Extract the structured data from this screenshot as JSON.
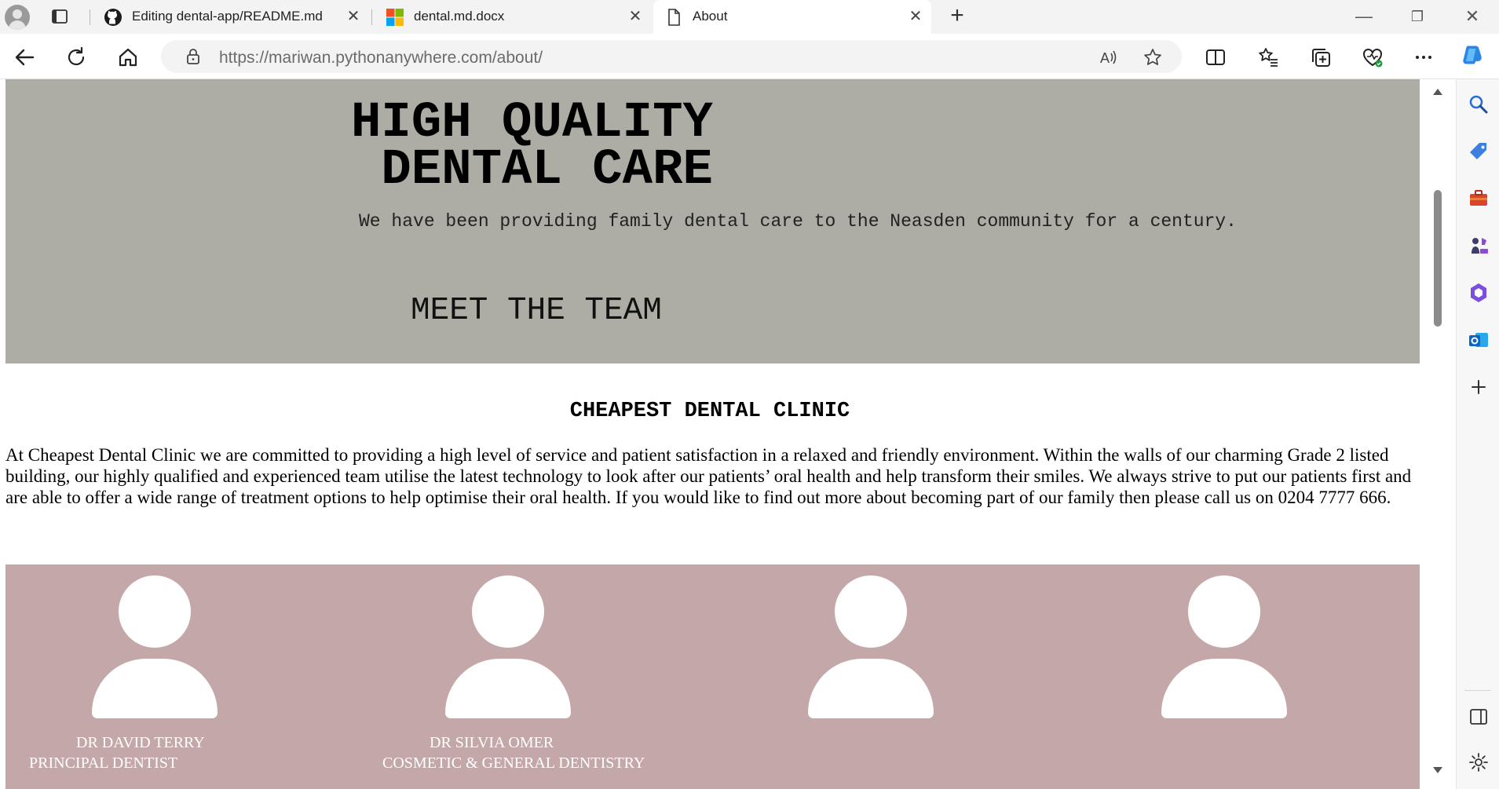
{
  "browser": {
    "tabs": [
      {
        "title": "Editing dental-app/README.md",
        "favicon": "github-icon",
        "active": false
      },
      {
        "title": "dental.md.docx",
        "favicon": "microsoft-icon",
        "active": false
      },
      {
        "title": "About",
        "favicon": "page-icon",
        "active": true
      }
    ],
    "address": {
      "url_host_part": "https://mariwan.pythonanywhere.com",
      "url_path_part": "/about/"
    }
  },
  "page": {
    "hero": {
      "title_line1": "HIGH QUALITY",
      "title_line2": " DENTAL CARE",
      "subtitle": "We have been providing family dental care to the Neasden community for a century.",
      "team_heading": "MEET THE TEAM",
      "background": "#adada5"
    },
    "clinic": {
      "title": "CHEAPEST DENTAL CLINIC",
      "description": "At Cheapest Dental Clinic we are committed to providing a high level of service and patient satisfaction in a relaxed and friendly environment. Within the walls of our charming Grade 2 listed building, our highly qualified and experienced team utilise the latest technology to look after our patients’ oral health and help transform their smiles. We always strive to put our patients first and are able to offer a wide range of treatment options to help optimise their oral health. If you would like to find out more about becoming part of our family then please call us on 0204 7777 666."
    },
    "team": {
      "background": "#c4a7a9",
      "members": [
        {
          "name": "DR DAVID TERRY",
          "role": "PRINCIPAL DENTIST"
        },
        {
          "name": "DR SILVIA OMER",
          "role": "COSMETIC & GENERAL DENTISTRY"
        },
        {
          "name": "",
          "role": ""
        },
        {
          "name": "",
          "role": ""
        }
      ]
    }
  }
}
